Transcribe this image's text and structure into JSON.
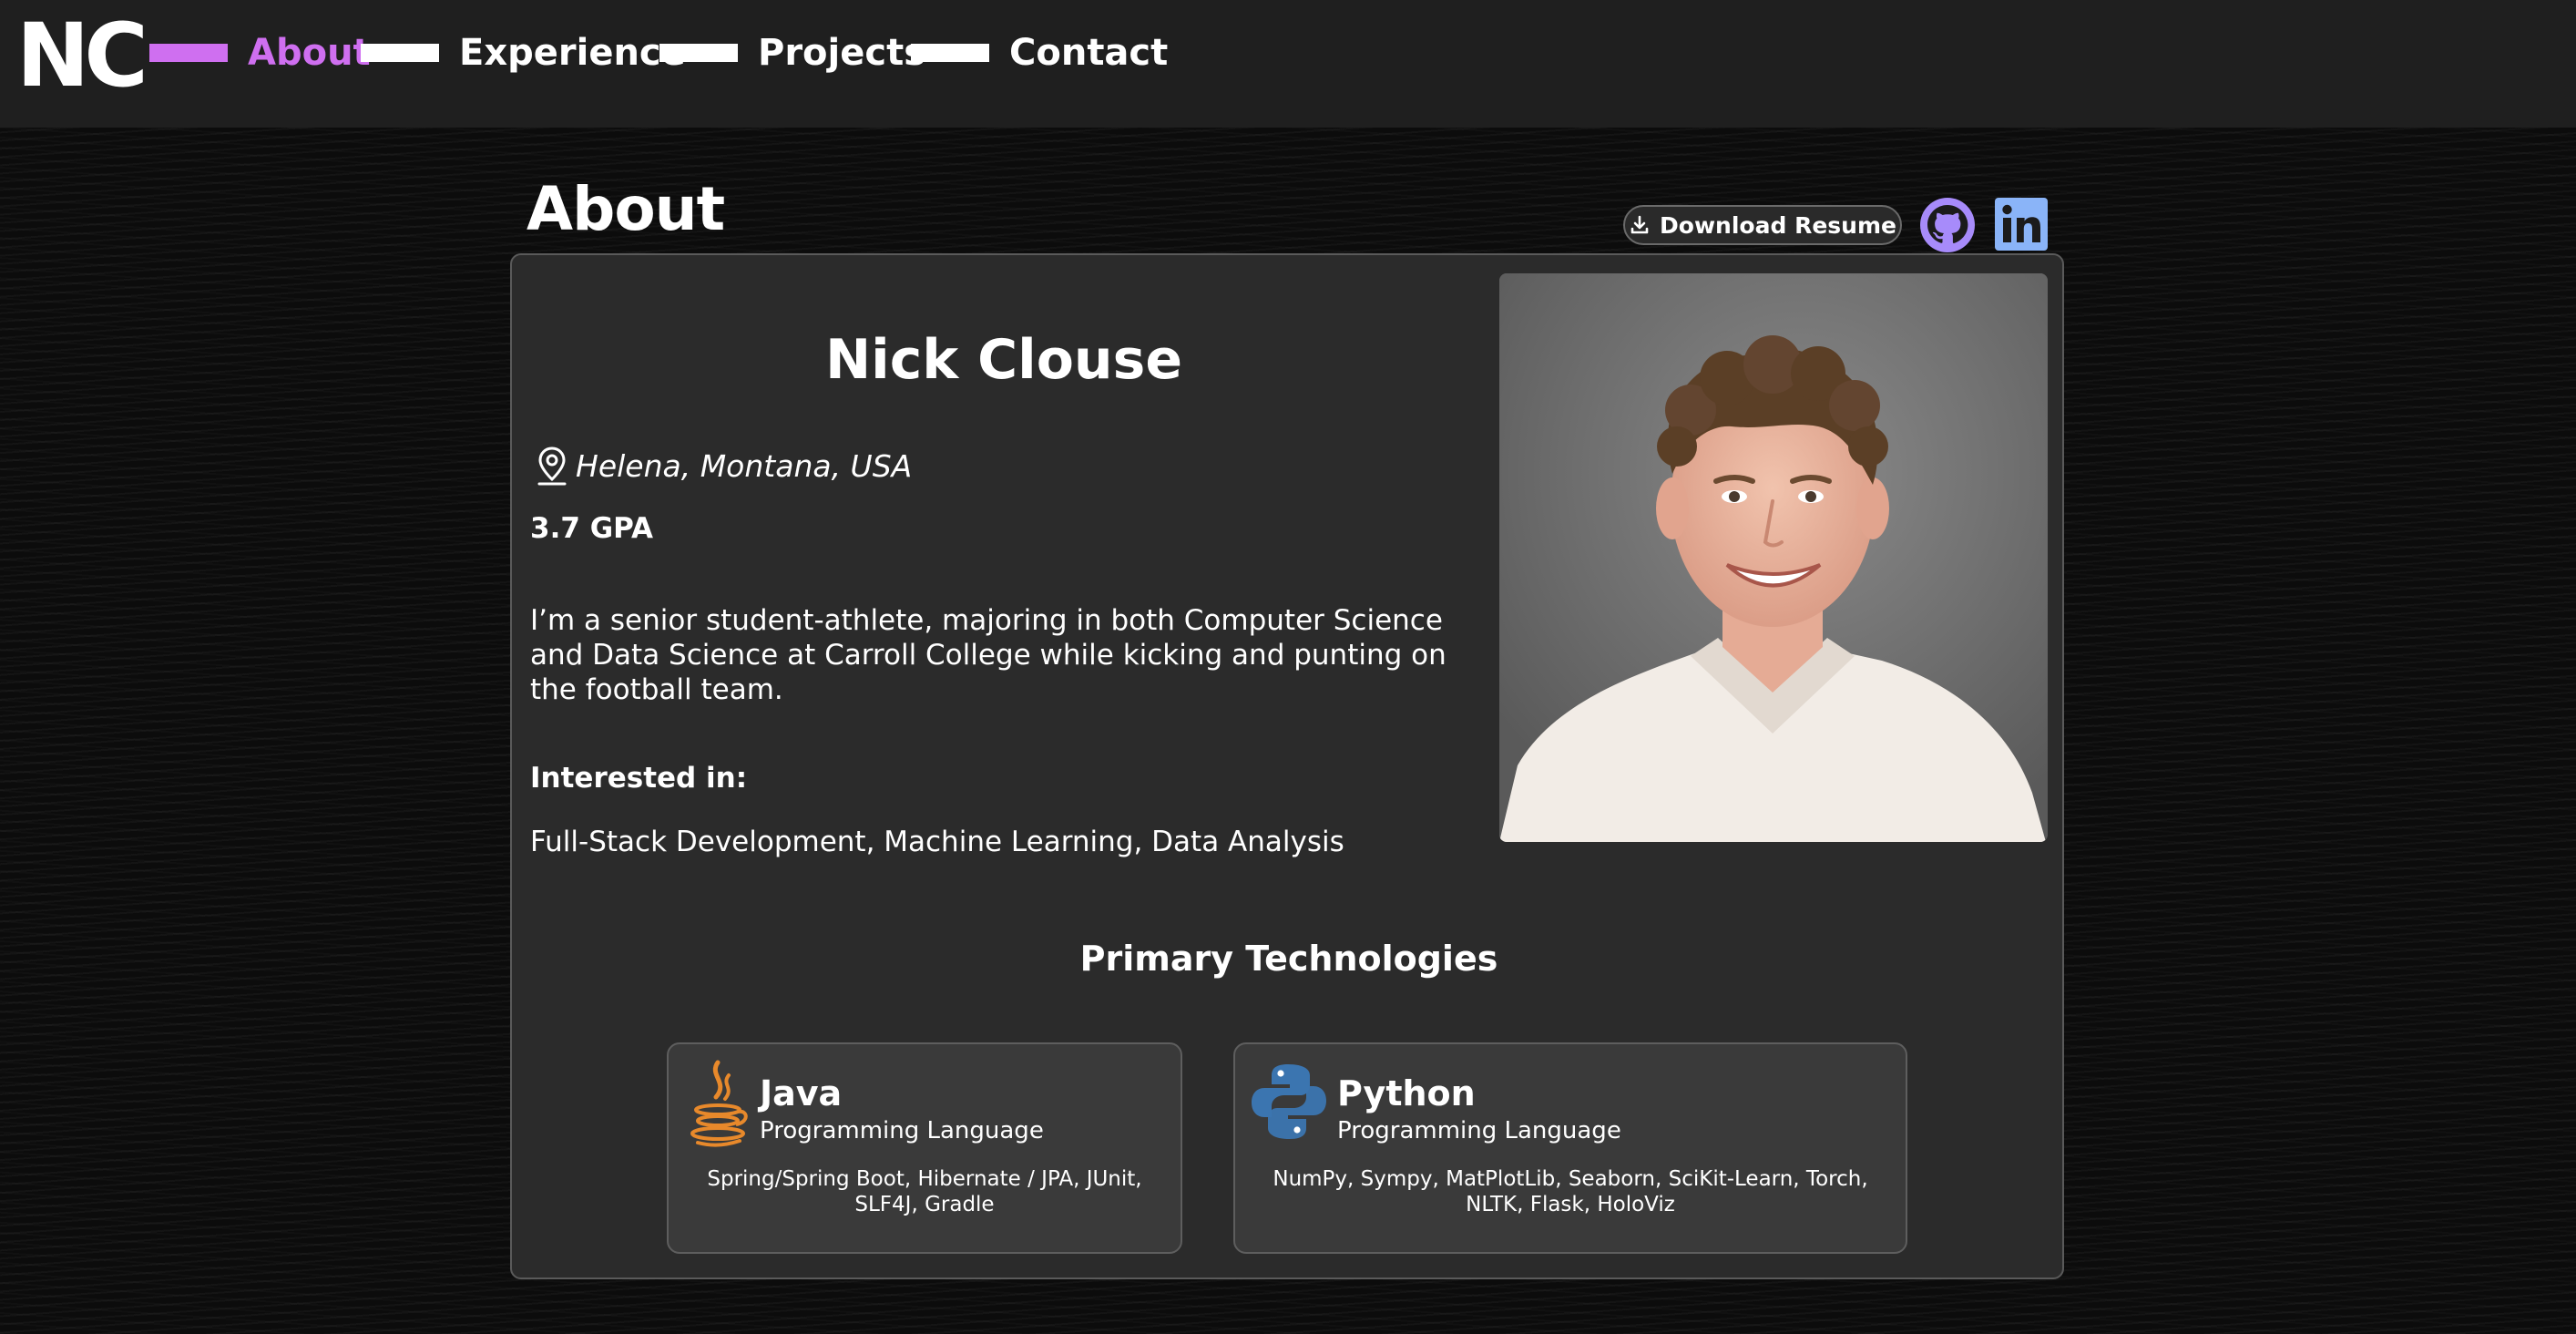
{
  "brand": "NC",
  "nav": {
    "items": [
      {
        "label": "About",
        "active": true
      },
      {
        "label": "Experience",
        "active": false
      },
      {
        "label": "Projects",
        "active": false
      },
      {
        "label": "Contact",
        "active": false
      }
    ]
  },
  "header": {
    "title": "About",
    "resume_label": "Download Resume",
    "resume_icon": "download-icon",
    "social": [
      "github-icon",
      "linkedin-icon"
    ]
  },
  "profile": {
    "name": "Nick Clouse",
    "location": "Helena, Montana, USA",
    "gpa": "3.7 GPA",
    "bio": "I’m a senior student-athlete, majoring in both Computer Science and Data Science at Carroll College while kicking and punting on the football team.",
    "interest_heading": "Interested in:",
    "interests": "Full-Stack Development, Machine Learning, Data Analysis",
    "photo": "profile-photo"
  },
  "technologies": {
    "heading": "Primary Technologies",
    "items": [
      {
        "name": "Java",
        "kind": "Programming Language",
        "libs": "Spring/Spring Boot, Hibernate / JPA, JUnit, SLF4J, Gradle",
        "icon": "java-icon"
      },
      {
        "name": "Python",
        "kind": "Programming Language",
        "libs": "NumPy, Sympy, MatPlotLib, Seaborn, SciKit-Learn, Torch, NLTK, Flask, HoloViz",
        "icon": "python-icon"
      }
    ]
  },
  "colors": {
    "accent": "#cf6ff0",
    "nav_bg": "#1f1f1f",
    "card_bg": "#2b2b2b",
    "tech_card_bg": "#3a3a3a",
    "github": "#a78bfa",
    "linkedin": "#8ab4f8"
  }
}
